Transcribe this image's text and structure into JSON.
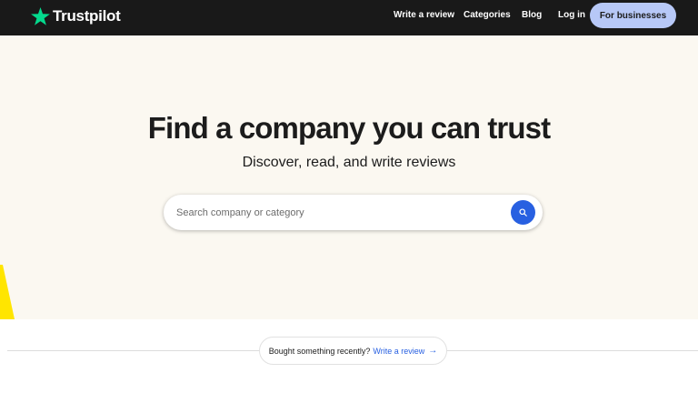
{
  "header": {
    "logo_text": "Trustpilot",
    "logo_icon": "star-icon",
    "nav": {
      "write_review": "Write a review",
      "categories": "Categories",
      "blog": "Blog",
      "login": "Log in"
    },
    "cta_label": "For businesses"
  },
  "hero": {
    "title": "Find a company you can trust",
    "subtitle": "Discover, read, and write reviews",
    "search": {
      "placeholder": "Search company or category",
      "value": "",
      "button_icon": "search-icon"
    }
  },
  "prompt": {
    "text": "Bought something recently?",
    "link": "Write a review",
    "link_icon": "arrow-right-icon"
  },
  "colors": {
    "header_bg": "#191919",
    "brand_star": "#04da8d",
    "cta_bg": "#b7c8f7",
    "hero_bg": "#fbf8f1",
    "accent_blue": "#2860e1",
    "yellow_accent": "#ffe500"
  }
}
